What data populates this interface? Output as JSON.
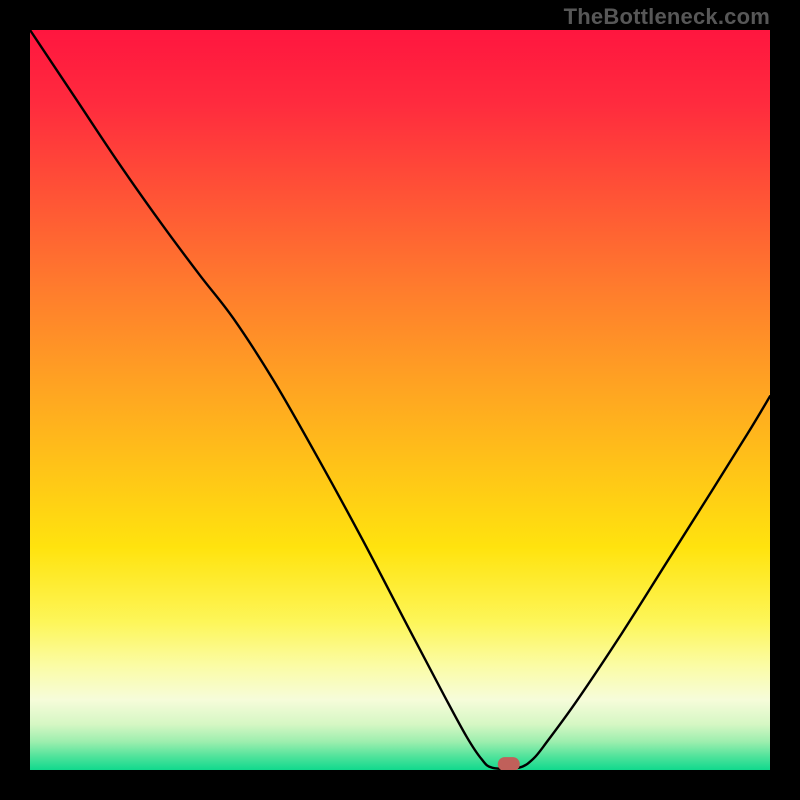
{
  "watermark": "TheBottleneck.com",
  "marker": {
    "x_frac": 0.647,
    "y_frac": 0.992,
    "color": "#c0605a",
    "rx": 11,
    "ry": 7
  },
  "gradient_stops": [
    {
      "offset": 0.0,
      "color": "#ff163f"
    },
    {
      "offset": 0.1,
      "color": "#ff2b3e"
    },
    {
      "offset": 0.22,
      "color": "#ff5236"
    },
    {
      "offset": 0.35,
      "color": "#ff7c2d"
    },
    {
      "offset": 0.48,
      "color": "#ffa322"
    },
    {
      "offset": 0.6,
      "color": "#ffc617"
    },
    {
      "offset": 0.7,
      "color": "#ffe30e"
    },
    {
      "offset": 0.8,
      "color": "#fdf659"
    },
    {
      "offset": 0.86,
      "color": "#fbfca6"
    },
    {
      "offset": 0.905,
      "color": "#f6fcda"
    },
    {
      "offset": 0.938,
      "color": "#d6f7c4"
    },
    {
      "offset": 0.962,
      "color": "#9ceeae"
    },
    {
      "offset": 0.982,
      "color": "#4fe39b"
    },
    {
      "offset": 1.0,
      "color": "#11d98d"
    }
  ],
  "chart_data": {
    "type": "line",
    "title": "",
    "xlabel": "",
    "ylabel": "",
    "xlim": [
      0,
      1
    ],
    "ylim": [
      0,
      1
    ],
    "note": "Axes unlabeled; x,y given as fractions of plot area (0=left/bottom, 1=right/top). Values read from pixel positions.",
    "series": [
      {
        "name": "curve",
        "points": [
          {
            "x": 0.0,
            "y": 1.0
          },
          {
            "x": 0.06,
            "y": 0.91
          },
          {
            "x": 0.12,
            "y": 0.82
          },
          {
            "x": 0.18,
            "y": 0.735
          },
          {
            "x": 0.23,
            "y": 0.668
          },
          {
            "x": 0.275,
            "y": 0.61
          },
          {
            "x": 0.33,
            "y": 0.525
          },
          {
            "x": 0.39,
            "y": 0.42
          },
          {
            "x": 0.45,
            "y": 0.31
          },
          {
            "x": 0.51,
            "y": 0.195
          },
          {
            "x": 0.56,
            "y": 0.1
          },
          {
            "x": 0.59,
            "y": 0.045
          },
          {
            "x": 0.61,
            "y": 0.015
          },
          {
            "x": 0.625,
            "y": 0.003
          },
          {
            "x": 0.66,
            "y": 0.003
          },
          {
            "x": 0.68,
            "y": 0.015
          },
          {
            "x": 0.7,
            "y": 0.04
          },
          {
            "x": 0.74,
            "y": 0.095
          },
          {
            "x": 0.8,
            "y": 0.185
          },
          {
            "x": 0.86,
            "y": 0.28
          },
          {
            "x": 0.92,
            "y": 0.375
          },
          {
            "x": 0.97,
            "y": 0.455
          },
          {
            "x": 1.0,
            "y": 0.505
          }
        ]
      }
    ]
  }
}
